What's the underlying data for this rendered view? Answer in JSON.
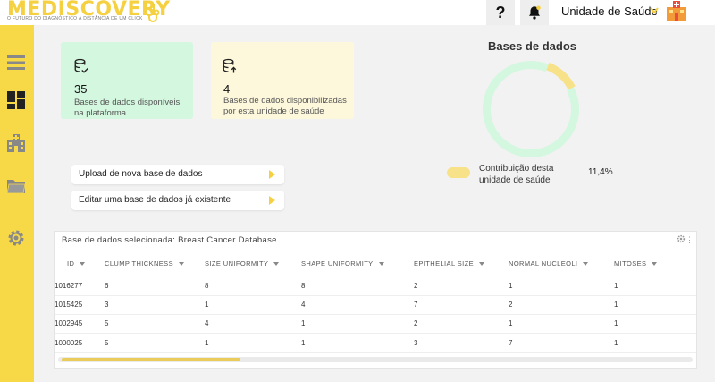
{
  "header": {
    "logo_text": "MEDISCOVERY",
    "logo_tagline": "O FUTURO DO DIAGNÓSTICO À DISTÂNCIA DE UM CLICK",
    "help_label": "?",
    "unit_selector": "Unidade de Saúde"
  },
  "sidebar": {
    "items": [
      {
        "name": "menu"
      },
      {
        "name": "dashboard"
      },
      {
        "name": "hospital"
      },
      {
        "name": "folder"
      },
      {
        "name": "settings"
      }
    ]
  },
  "cards": [
    {
      "count": "35",
      "label": "Bases de dados disponíveis na plataforma",
      "color": "#d4f7df"
    },
    {
      "count": "4",
      "label": "Bases de dados disponibilizadas por esta unidade de saúde",
      "color": "#fdf8dc"
    }
  ],
  "actions": [
    {
      "label": "Upload de nova base de dados"
    },
    {
      "label": "Editar uma base de dados já existente"
    }
  ],
  "chart": {
    "title": "Bases de dados",
    "legend_label": "Contribuição desta unidade de saúde",
    "legend_value": "11,4%",
    "chart_data": {
      "type": "pie",
      "title": "Bases de dados",
      "slices": [
        {
          "label": "Contribuição desta unidade de saúde",
          "value": 11.4,
          "color": "#f7e28a"
        },
        {
          "label": "",
          "value": 88.6,
          "color": "#d4f7df"
        }
      ]
    }
  },
  "table": {
    "title": "Base de dados selecionada: Breast Cancer Database",
    "columns": [
      "ID",
      "CLUMP THICKNESS",
      "SIZE UNIFORMITY",
      "SHAPE UNIFORMITY",
      "EPITHELIAL SIZE",
      "NORMAL NUCLEOLI",
      "MITOSES"
    ],
    "rows": [
      [
        "1016277",
        "6",
        "8",
        "8",
        "2",
        "1",
        "1"
      ],
      [
        "1015425",
        "3",
        "1",
        "4",
        "7",
        "2",
        "1"
      ],
      [
        "1002945",
        "5",
        "4",
        "1",
        "2",
        "1",
        "1"
      ],
      [
        "1000025",
        "5",
        "1",
        "1",
        "3",
        "7",
        "1"
      ]
    ]
  },
  "colors": {
    "accent": "#f7d948",
    "green_soft": "#d4f7df",
    "yellow_soft": "#fdf8dc"
  }
}
